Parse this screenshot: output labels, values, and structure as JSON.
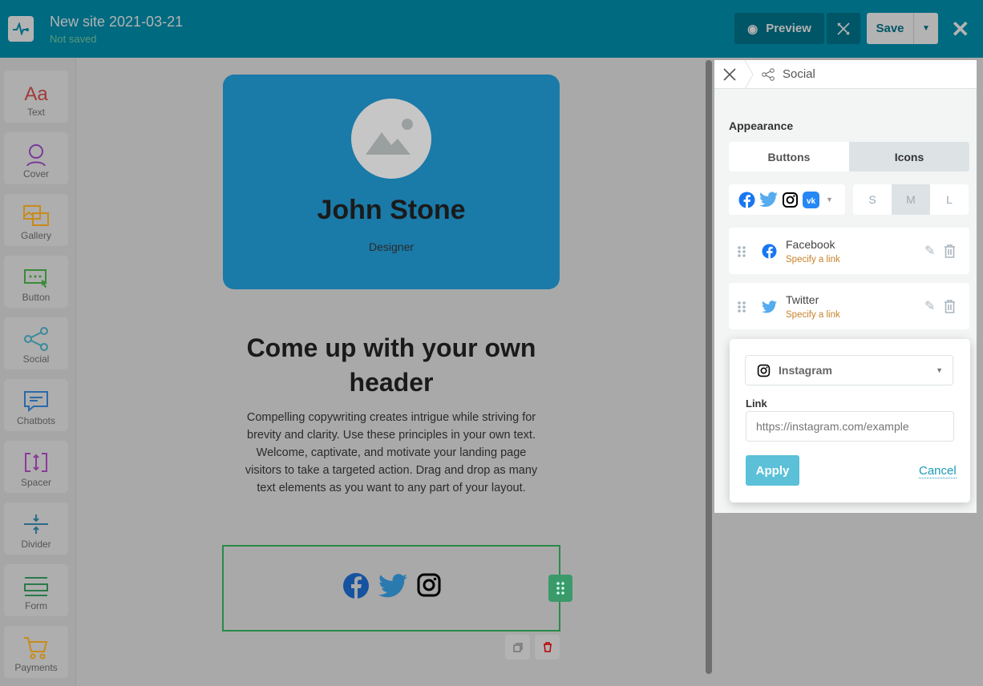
{
  "header": {
    "title": "New site 2021-03-21",
    "status": "Not saved",
    "preview": "Preview",
    "save": "Save"
  },
  "sidebar": {
    "items": [
      {
        "label": "Text",
        "icon": "text-icon",
        "color": "#a33a3a"
      },
      {
        "label": "Cover",
        "icon": "cover-icon",
        "color": "#7a3a9a"
      },
      {
        "label": "Gallery",
        "icon": "gallery-icon",
        "color": "#c98a1a"
      },
      {
        "label": "Button",
        "icon": "button-icon",
        "color": "#3a8a3a"
      },
      {
        "label": "Social",
        "icon": "social-icon",
        "color": "#3a8a9a"
      },
      {
        "label": "Chatbots",
        "icon": "chatbots-icon",
        "color": "#2a6aaa"
      },
      {
        "label": "Spacer",
        "icon": "spacer-icon",
        "color": "#8a3a9a"
      },
      {
        "label": "Divider",
        "icon": "divider-icon",
        "color": "#2a6a8a"
      },
      {
        "label": "Form",
        "icon": "form-icon",
        "color": "#2a7a4a"
      },
      {
        "label": "Payments",
        "icon": "payments-icon",
        "color": "#c98a1a"
      }
    ]
  },
  "canvas": {
    "name": "John Stone",
    "role": "Designer",
    "heading": "Come up with your own header",
    "paragraph": "Compelling copywriting creates intrigue while striving for brevity and clarity. Use these principles in your own text. Welcome, captivate, and motivate your landing page visitors to take a targeted action. Drag and drop as many text elements as you want to any part of your layout."
  },
  "panel": {
    "breadcrumb": "Social",
    "appearance": "Appearance",
    "tabs": [
      "Buttons",
      "Icons"
    ],
    "active_tab": "Icons",
    "sizes": [
      "S",
      "M",
      "L"
    ],
    "active_size": "M",
    "networks": [
      {
        "name": "Facebook",
        "link": "Specify a link"
      },
      {
        "name": "Twitter",
        "link": "Specify a link"
      }
    ],
    "popup": {
      "network": "Instagram",
      "link_label": "Link",
      "placeholder": "https://instagram.com/example",
      "apply": "Apply",
      "cancel": "Cancel"
    }
  }
}
